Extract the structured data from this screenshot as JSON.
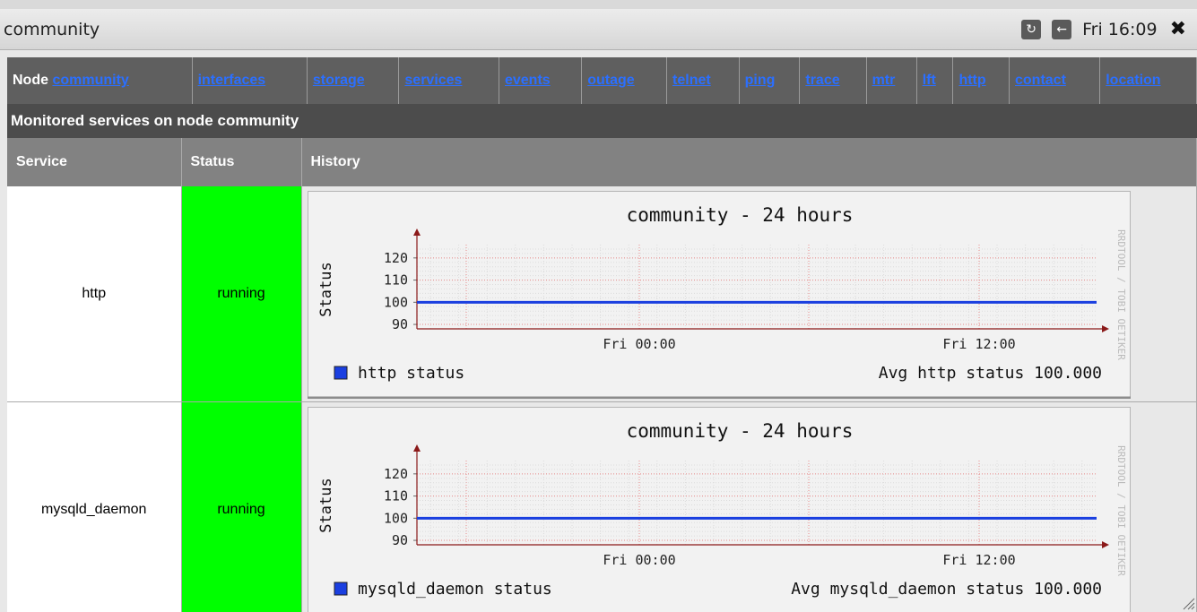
{
  "window": {
    "title": "community",
    "clock": "Fri 16:09",
    "icons": [
      "reload-icon",
      "back-arrow-icon",
      "close-icon"
    ]
  },
  "nav": {
    "node_label": "Node",
    "links": [
      "community",
      "interfaces",
      "storage",
      "services",
      "events",
      "outage",
      "telnet",
      "ping",
      "trace",
      "mtr",
      "lft",
      "http",
      "contact",
      "location"
    ]
  },
  "section_title": "Monitored services on node community",
  "table": {
    "headers": [
      "Service",
      "Status",
      "History"
    ],
    "rows": [
      {
        "service": "http",
        "status": "running"
      },
      {
        "service": "mysqld_daemon",
        "status": "running"
      }
    ]
  },
  "colors": {
    "status_running": "#00ff00",
    "link": "#2b6fff",
    "series_line": "#1a3fe0",
    "axis": "#8b1a1a",
    "grid": "#e88a8a"
  },
  "chart_data": [
    {
      "type": "line",
      "title": "community - 24 hours",
      "ylabel": "Status",
      "xlabel": "",
      "ylim": [
        88,
        126
      ],
      "yticks": [
        90,
        100,
        110,
        120
      ],
      "xtick_labels": [
        "Fri 00:00",
        "Fri 12:00"
      ],
      "grid": true,
      "watermark": "RRDTOOL / TOBI OETIKER",
      "series": [
        {
          "name": "http status",
          "values": [
            100,
            100,
            100,
            100,
            100,
            100,
            100,
            100,
            100,
            100,
            100,
            100,
            100,
            100,
            100,
            100,
            100,
            100,
            100,
            100,
            100,
            100,
            100,
            100,
            100
          ]
        }
      ],
      "legend": {
        "item": "http status",
        "summary": "Avg http status 100.000"
      }
    },
    {
      "type": "line",
      "title": "community - 24 hours",
      "ylabel": "Status",
      "xlabel": "",
      "ylim": [
        88,
        126
      ],
      "yticks": [
        90,
        100,
        110,
        120
      ],
      "xtick_labels": [
        "Fri 00:00",
        "Fri 12:00"
      ],
      "grid": true,
      "watermark": "RRDTOOL / TOBI OETIKER",
      "series": [
        {
          "name": "mysqld_daemon status",
          "values": [
            100,
            100,
            100,
            100,
            100,
            100,
            100,
            100,
            100,
            100,
            100,
            100,
            100,
            100,
            100,
            100,
            100,
            100,
            100,
            100,
            100,
            100,
            100,
            100,
            100
          ]
        }
      ],
      "legend": {
        "item": "mysqld_daemon status",
        "summary": "Avg mysqld_daemon status 100.000"
      }
    }
  ]
}
